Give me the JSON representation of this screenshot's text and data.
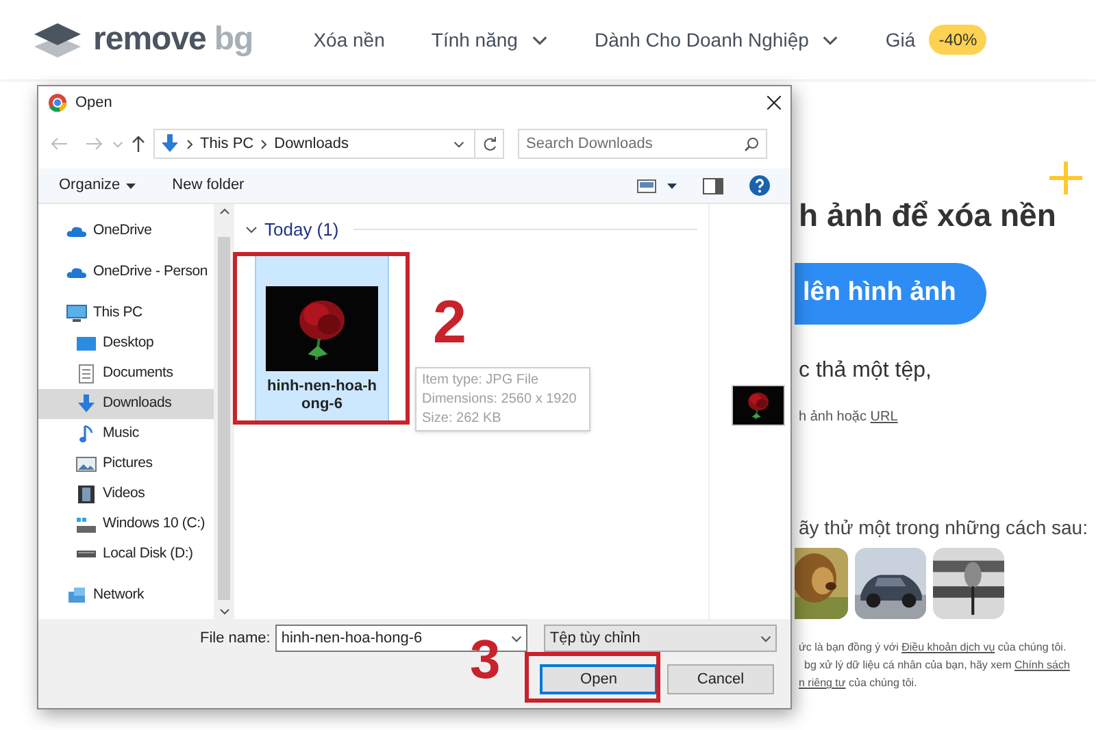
{
  "header": {
    "logo": {
      "word": "remove",
      "suffix": "bg"
    },
    "nav": [
      {
        "label": "Xóa nền",
        "dropdown": false
      },
      {
        "label": "Tính năng",
        "dropdown": true
      },
      {
        "label": "Dành Cho Doanh Nghiệp",
        "dropdown": true
      },
      {
        "label": "Giá",
        "dropdown": false,
        "badge": "-40%"
      }
    ]
  },
  "hero": {
    "title": "h ảnh để xóa nền",
    "upload_button": "lên hình ảnh",
    "drop_text": "c thả một tệp,",
    "paste_text": {
      "text": "h ảnh hoặc",
      "link": "URL"
    },
    "samples_title": "ãy thử một trong những cách sau:",
    "samples": [
      {
        "kind": "picture"
      },
      {
        "kind": "picture"
      },
      {
        "kind": "picture"
      }
    ],
    "legal": [
      [
        {
          "kind": "text",
          "text": "ức là bạn đồng ý với "
        },
        {
          "kind": "link",
          "text": "Điều khoản dịch vụ"
        },
        {
          "kind": "text",
          "text": " của chúng tôi."
        }
      ],
      [
        {
          "kind": "text",
          "text": "bg xử lý dữ liệu cá nhân của bạn, hãy xem "
        },
        {
          "kind": "link",
          "text": "Chính sách"
        }
      ],
      [
        {
          "kind": "link",
          "text": "n riêng tư"
        },
        {
          "kind": "text",
          "text": " của chúng tôi."
        }
      ]
    ]
  },
  "dialog": {
    "title": "Open",
    "breadcrumb": [
      "This PC",
      "Downloads"
    ],
    "search": {
      "placeholder": "Search Downloads"
    },
    "toolbar": {
      "organize": "Organize",
      "new_folder": "New folder"
    },
    "sidebar": {
      "items": [
        {
          "label": "OneDrive",
          "kind": "cloud",
          "selected": false
        },
        {
          "label": "OneDrive - Person",
          "kind": "cloud",
          "selected": false
        },
        {
          "label": "This PC",
          "kind": "pc",
          "selected": false,
          "children": [
            {
              "label": "Desktop",
              "kind": "desktop",
              "selected": false
            },
            {
              "label": "Documents",
              "kind": "documents",
              "selected": false
            },
            {
              "label": "Downloads",
              "kind": "download",
              "selected": true
            },
            {
              "label": "Music",
              "kind": "music",
              "selected": false
            },
            {
              "label": "Pictures",
              "kind": "pictures",
              "selected": false
            },
            {
              "label": "Videos",
              "kind": "videos",
              "selected": false
            },
            {
              "label": "Windows 10 (C:)",
              "kind": "system-drive",
              "selected": false
            },
            {
              "label": "Local Disk (D:)",
              "kind": "drive",
              "selected": false
            }
          ]
        },
        {
          "label": "Network",
          "kind": "network",
          "selected": false
        }
      ]
    },
    "group": {
      "label": "Today (1)",
      "expanded": true
    },
    "files": [
      {
        "name_lines": [
          "hinh-nen-hoa-h",
          "ong-6"
        ],
        "selected": true,
        "kind": "picture"
      }
    ],
    "tooltip": [
      "Item type: JPG File",
      "Dimensions: 2560 x 1920",
      "Size: 262 KB"
    ],
    "file_name": {
      "label": "File name:",
      "value": "hinh-nen-hoa-hong-6"
    },
    "file_type": "Tệp tùy chỉnh",
    "buttons": [
      {
        "label": "Open",
        "default": true
      },
      {
        "label": "Cancel",
        "default": false
      }
    ]
  },
  "annotations": [
    {
      "label": "2"
    },
    {
      "label": "3"
    }
  ]
}
